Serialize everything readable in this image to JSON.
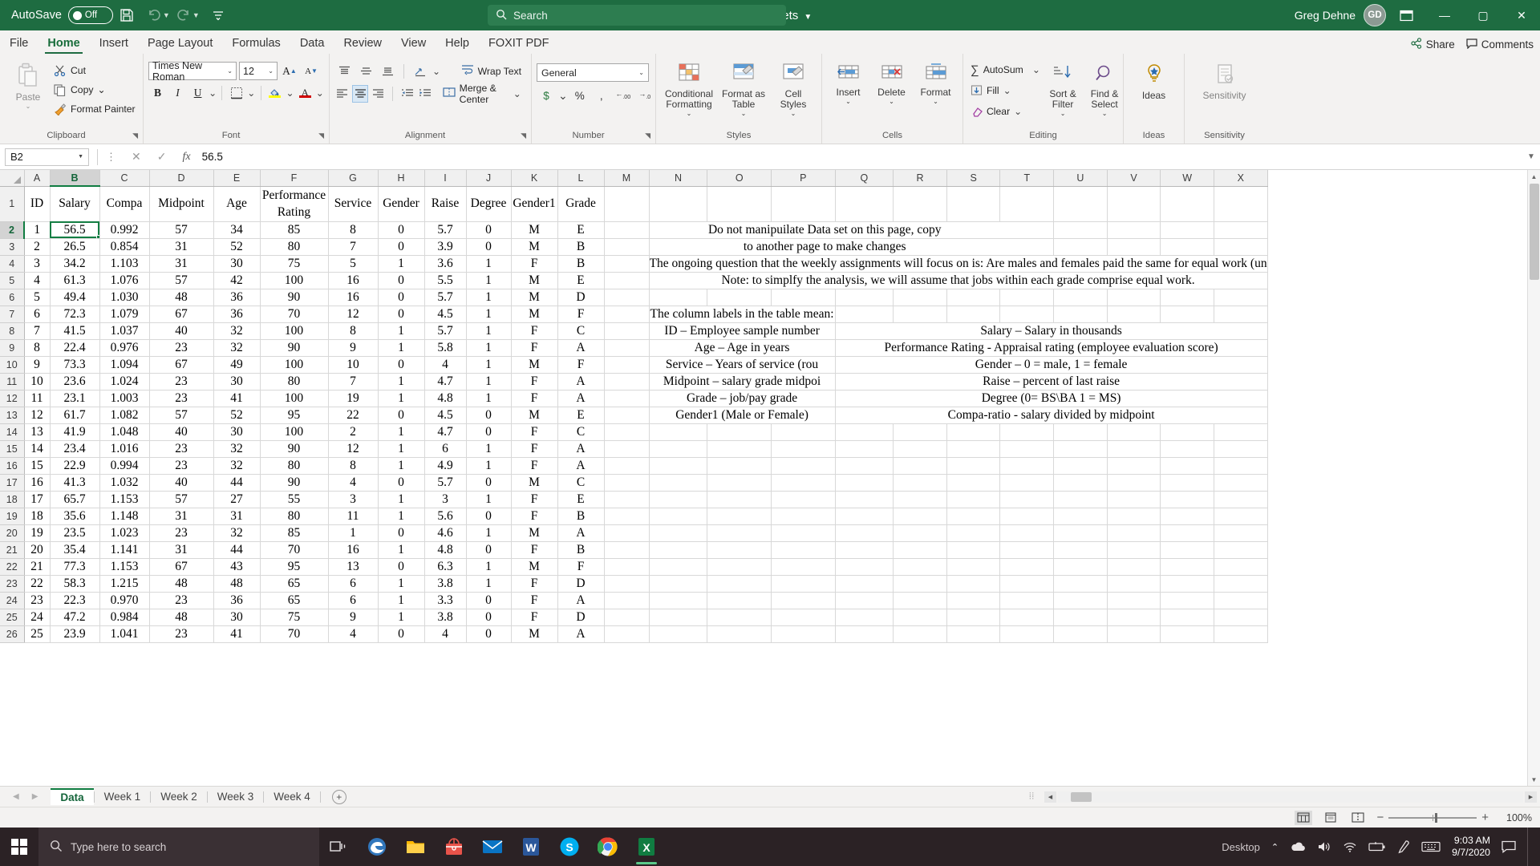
{
  "titlebar": {
    "autosave_label": "AutoSave",
    "autosave_state": "Off",
    "save_icon": "save-icon",
    "undo_icon": "undo-icon",
    "redo_icon": "redo-icon",
    "customize_icon": "customize-quick-access-icon",
    "document_title": "Problem sets",
    "search_placeholder": "Search",
    "search_icon": "search-icon",
    "user_name": "Greg Dehne",
    "user_initials": "GD",
    "ribbon_display_icon": "ribbon-display-options-icon",
    "minimize": "—",
    "maximize": "▢",
    "close": "✕"
  },
  "menu": {
    "tabs": [
      {
        "label": "File",
        "active": false
      },
      {
        "label": "Home",
        "active": true
      },
      {
        "label": "Insert",
        "active": false
      },
      {
        "label": "Page Layout",
        "active": false
      },
      {
        "label": "Formulas",
        "active": false
      },
      {
        "label": "Data",
        "active": false
      },
      {
        "label": "Review",
        "active": false
      },
      {
        "label": "View",
        "active": false
      },
      {
        "label": "Help",
        "active": false
      },
      {
        "label": "FOXIT PDF",
        "active": false
      }
    ],
    "share_label": "Share",
    "comments_label": "Comments"
  },
  "ribbon": {
    "clipboard": {
      "group_label": "Clipboard",
      "paste_label": "Paste",
      "cut_label": "Cut",
      "copy_label": "Copy",
      "format_painter_label": "Format Painter"
    },
    "font": {
      "group_label": "Font",
      "font_name": "Times New Roman",
      "font_size": "12",
      "grow_font": "A",
      "shrink_font": "A",
      "bold": "B",
      "italic": "I",
      "underline": "U",
      "borders_icon": "borders-icon",
      "fill_color_icon": "fill-color-icon",
      "font_color_icon": "font-color-icon"
    },
    "alignment": {
      "group_label": "Alignment",
      "wrap_text_label": "Wrap Text",
      "merge_center_label": "Merge & Center",
      "orientation_icon": "text-orientation-icon",
      "indent_decrease_icon": "decrease-indent-icon",
      "indent_increase_icon": "increase-indent-icon"
    },
    "number": {
      "group_label": "Number",
      "format_value": "General",
      "currency_icon": "currency-icon",
      "percent_icon": "percent-style-icon",
      "comma_icon": "comma-style-icon",
      "increase_decimal_icon": "increase-decimal-icon",
      "decrease_decimal_icon": "decrease-decimal-icon",
      "increase_decimal_label": ".00",
      "decrease_decimal_label": ".00"
    },
    "styles": {
      "group_label": "Styles",
      "conditional_formatting_label": "Conditional Formatting",
      "format_as_table_label": "Format as Table",
      "cell_styles_label": "Cell Styles"
    },
    "cells": {
      "group_label": "Cells",
      "insert_label": "Insert",
      "delete_label": "Delete",
      "format_label": "Format"
    },
    "editing": {
      "group_label": "Editing",
      "autosum_label": "AutoSum",
      "fill_label": "Fill",
      "clear_label": "Clear",
      "sort_filter_label": "Sort & Filter",
      "find_select_label": "Find & Select"
    },
    "ideas": {
      "group_label": "Ideas",
      "ideas_label": "Ideas"
    },
    "sensitivity": {
      "group_label": "Sensitivity",
      "sensitivity_label": "Sensitivity"
    }
  },
  "formula_bar": {
    "name_box": "B2",
    "cancel_icon": "cancel-icon",
    "enter_icon": "enter-icon",
    "function_icon": "insert-function-icon",
    "formula_value": "56.5",
    "expand_icon": "expand-formula-bar-icon"
  },
  "grid": {
    "column_letters": [
      "A",
      "B",
      "C",
      "D",
      "E",
      "F",
      "G",
      "H",
      "I",
      "J",
      "K",
      "L",
      "M",
      "N",
      "O",
      "P",
      "Q",
      "R",
      "S",
      "T",
      "U",
      "V",
      "W",
      "X"
    ],
    "selected_column": "B",
    "selected_row": 2,
    "selected_cell": "B2",
    "row_numbers": [
      1,
      2,
      3,
      4,
      5,
      6,
      7,
      8,
      9,
      10,
      11,
      12,
      13,
      14,
      15,
      16,
      17,
      18,
      19,
      20,
      21,
      22,
      23,
      24,
      25,
      26
    ],
    "headers": [
      "ID",
      "Salary",
      "Compa",
      "Midpoint",
      "Age",
      "Performance Rating",
      "Service",
      "Gender",
      "Raise",
      "Degree",
      "Gender1",
      "Grade"
    ],
    "rows": [
      [
        "1",
        "56.5",
        "0.992",
        "57",
        "34",
        "85",
        "8",
        "0",
        "5.7",
        "0",
        "M",
        "E"
      ],
      [
        "2",
        "26.5",
        "0.854",
        "31",
        "52",
        "80",
        "7",
        "0",
        "3.9",
        "0",
        "M",
        "B"
      ],
      [
        "3",
        "34.2",
        "1.103",
        "31",
        "30",
        "75",
        "5",
        "1",
        "3.6",
        "1",
        "F",
        "B"
      ],
      [
        "4",
        "61.3",
        "1.076",
        "57",
        "42",
        "100",
        "16",
        "0",
        "5.5",
        "1",
        "M",
        "E"
      ],
      [
        "5",
        "49.4",
        "1.030",
        "48",
        "36",
        "90",
        "16",
        "0",
        "5.7",
        "1",
        "M",
        "D"
      ],
      [
        "6",
        "72.3",
        "1.079",
        "67",
        "36",
        "70",
        "12",
        "0",
        "4.5",
        "1",
        "M",
        "F"
      ],
      [
        "7",
        "41.5",
        "1.037",
        "40",
        "32",
        "100",
        "8",
        "1",
        "5.7",
        "1",
        "F",
        "C"
      ],
      [
        "8",
        "22.4",
        "0.976",
        "23",
        "32",
        "90",
        "9",
        "1",
        "5.8",
        "1",
        "F",
        "A"
      ],
      [
        "9",
        "73.3",
        "1.094",
        "67",
        "49",
        "100",
        "10",
        "0",
        "4",
        "1",
        "M",
        "F"
      ],
      [
        "10",
        "23.6",
        "1.024",
        "23",
        "30",
        "80",
        "7",
        "1",
        "4.7",
        "1",
        "F",
        "A"
      ],
      [
        "11",
        "23.1",
        "1.003",
        "23",
        "41",
        "100",
        "19",
        "1",
        "4.8",
        "1",
        "F",
        "A"
      ],
      [
        "12",
        "61.7",
        "1.082",
        "57",
        "52",
        "95",
        "22",
        "0",
        "4.5",
        "0",
        "M",
        "E"
      ],
      [
        "13",
        "41.9",
        "1.048",
        "40",
        "30",
        "100",
        "2",
        "1",
        "4.7",
        "0",
        "F",
        "C"
      ],
      [
        "14",
        "23.4",
        "1.016",
        "23",
        "32",
        "90",
        "12",
        "1",
        "6",
        "1",
        "F",
        "A"
      ],
      [
        "15",
        "22.9",
        "0.994",
        "23",
        "32",
        "80",
        "8",
        "1",
        "4.9",
        "1",
        "F",
        "A"
      ],
      [
        "16",
        "41.3",
        "1.032",
        "40",
        "44",
        "90",
        "4",
        "0",
        "5.7",
        "0",
        "M",
        "C"
      ],
      [
        "17",
        "65.7",
        "1.153",
        "57",
        "27",
        "55",
        "3",
        "1",
        "3",
        "1",
        "F",
        "E"
      ],
      [
        "18",
        "35.6",
        "1.148",
        "31",
        "31",
        "80",
        "11",
        "1",
        "5.6",
        "0",
        "F",
        "B"
      ],
      [
        "19",
        "23.5",
        "1.023",
        "23",
        "32",
        "85",
        "1",
        "0",
        "4.6",
        "1",
        "M",
        "A"
      ],
      [
        "20",
        "35.4",
        "1.141",
        "31",
        "44",
        "70",
        "16",
        "1",
        "4.8",
        "0",
        "F",
        "B"
      ],
      [
        "21",
        "77.3",
        "1.153",
        "67",
        "43",
        "95",
        "13",
        "0",
        "6.3",
        "1",
        "M",
        "F"
      ],
      [
        "22",
        "58.3",
        "1.215",
        "48",
        "48",
        "65",
        "6",
        "1",
        "3.8",
        "1",
        "F",
        "D"
      ],
      [
        "23",
        "22.3",
        "0.970",
        "23",
        "36",
        "65",
        "6",
        "1",
        "3.3",
        "0",
        "F",
        "A"
      ],
      [
        "24",
        "47.2",
        "0.984",
        "48",
        "30",
        "75",
        "9",
        "1",
        "3.8",
        "0",
        "F",
        "D"
      ],
      [
        "25",
        "23.9",
        "1.041",
        "23",
        "41",
        "70",
        "4",
        "0",
        "4",
        "0",
        "M",
        "A"
      ]
    ],
    "notes": {
      "red_line1": "Do not manipuilate Data set on this page, copy",
      "red_line2": "to another page to make changes",
      "ongoing_question": "The ongoing question that the weekly assignments will focus on is:  Are males and females paid the same for equal work (un",
      "note_simplify": "Note: to simplfy the analysis, we will assume that jobs within each grade comprise equal work.",
      "labels_intro": "The column labels in the  table mean:",
      "defs": [
        {
          "left": "ID – Employee sample number",
          "right": "Salary – Salary in thousands"
        },
        {
          "left": "Age – Age in years",
          "right": "Performance Rating - Appraisal rating (employee evaluation score)"
        },
        {
          "left": "Service – Years of service (rou",
          "right": "Gender – 0 = male, 1 = female"
        },
        {
          "left": "Midpoint – salary grade midpoi",
          "right": "Raise – percent of last raise"
        },
        {
          "left": "Grade – job/pay grade",
          "right": "Degree (0= BS\\BA 1 = MS)"
        },
        {
          "left": "Gender1 (Male or Female)",
          "right": "Compa-ratio - salary divided by midpoint"
        }
      ]
    }
  },
  "sheet_tabs": {
    "tabs": [
      {
        "label": "Data",
        "active": true
      },
      {
        "label": "Week 1",
        "active": false
      },
      {
        "label": "Week 2",
        "active": false
      },
      {
        "label": "Week 3",
        "active": false
      },
      {
        "label": "Week 4",
        "active": false
      }
    ],
    "add_sheet_label": "+",
    "prev_icon": "previous-sheet-icon",
    "next_icon": "next-sheet-icon"
  },
  "status_bar": {
    "normal_view_icon": "normal-view-icon",
    "page_layout_icon": "page-layout-view-icon",
    "page_break_icon": "page-break-preview-icon",
    "zoom_out": "−",
    "zoom_in": "+",
    "zoom_level": "100%"
  },
  "taskbar": {
    "search_placeholder": "Type here to search",
    "search_icon": "taskbar-search-icon",
    "start_icon": "windows-start-icon",
    "task_view_icon": "task-view-icon",
    "apps": [
      {
        "name": "microsoft-edge",
        "glyph": "e",
        "color": "#3277bc"
      },
      {
        "name": "file-explorer",
        "glyph": "",
        "color": "#ffb900"
      },
      {
        "name": "microsoft-store",
        "glyph": "",
        "color": "#e8534a"
      },
      {
        "name": "mail",
        "glyph": "",
        "color": "#0a74c4"
      },
      {
        "name": "word",
        "glyph": "W",
        "color": "#2b579a"
      },
      {
        "name": "skype",
        "glyph": "S",
        "color": "#00aff0"
      },
      {
        "name": "chrome",
        "glyph": "",
        "color": "#4285f4"
      },
      {
        "name": "excel",
        "glyph": "X",
        "color": "#107c41"
      }
    ],
    "desktop_label": "Desktop",
    "overflow_icon": "show-hidden-icons-icon",
    "onedrive_icon": "onedrive-icon",
    "volume_icon": "volume-icon",
    "network_icon": "wifi-icon",
    "battery_icon": "battery-icon",
    "pen_icon": "pen-icon",
    "keyboard_icon": "touch-keyboard-icon",
    "time": "9:03 AM",
    "date": "9/7/2020",
    "notification_icon": "action-center-icon"
  }
}
